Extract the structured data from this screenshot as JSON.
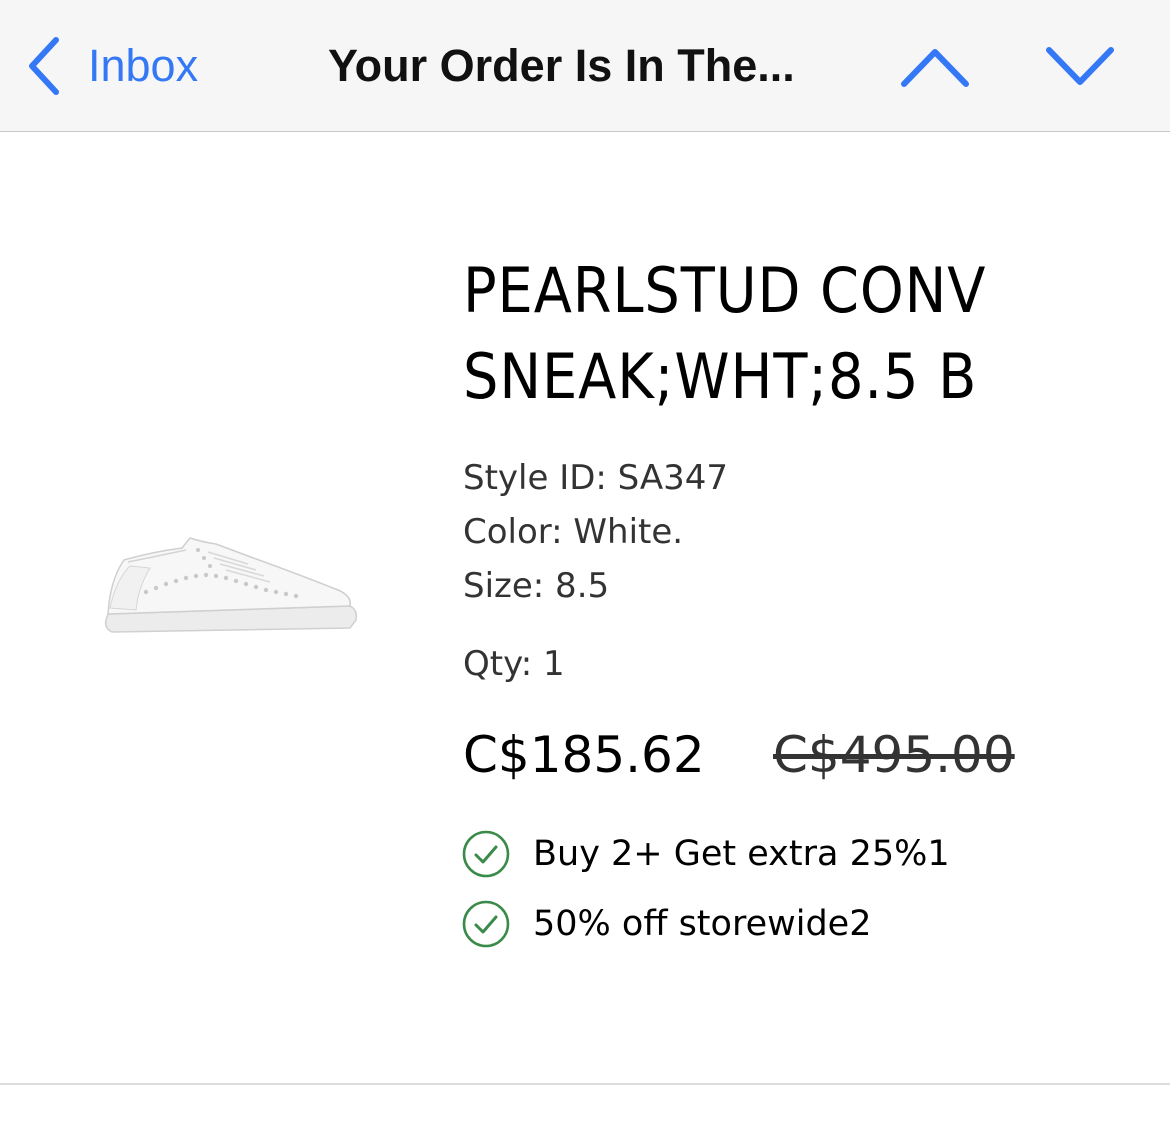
{
  "nav": {
    "back_label": "Inbox",
    "title": "Your Order Is In The...",
    "accent_color": "#3478f6"
  },
  "product": {
    "image_icon": "white-sneaker-image",
    "name_line1": "PEARLSTUD CONV",
    "name_line2": "SNEAK;WHT;8.5 B",
    "style_id": "Style ID: SA347",
    "color": "Color: White.",
    "size": "Size: 8.5",
    "qty": "Qty: 1",
    "sale_price": "C$185.62",
    "original_price": "C$495.00"
  },
  "promotions": [
    {
      "label": "Buy 2+ Get extra 25%1",
      "icon": "check-circle-icon"
    },
    {
      "label": "50% off storewide2",
      "icon": "check-circle-icon"
    }
  ],
  "colors": {
    "check": "#3a8a4a"
  }
}
